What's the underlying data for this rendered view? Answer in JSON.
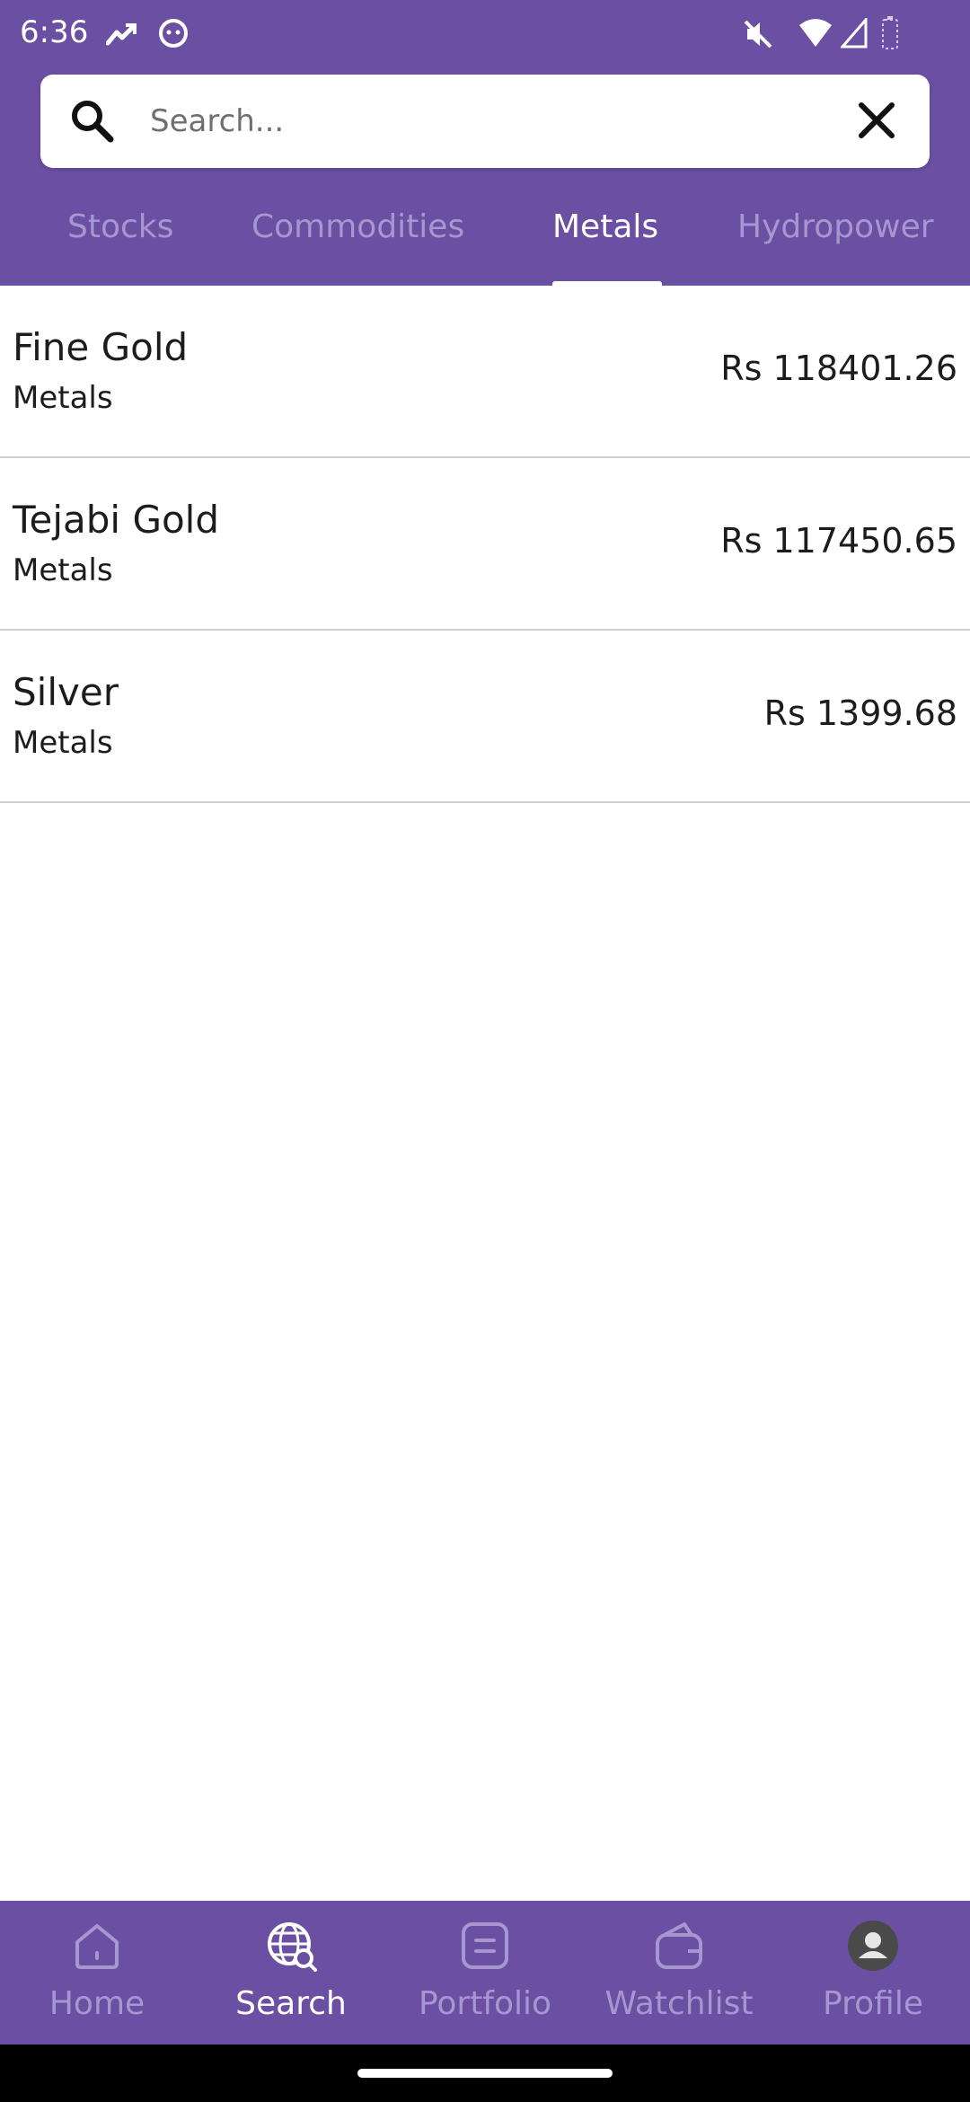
{
  "status_bar": {
    "time": "6:36"
  },
  "search": {
    "placeholder": "Search...",
    "value": ""
  },
  "tabs": [
    {
      "label": "Stocks",
      "active": false
    },
    {
      "label": "Commodities",
      "active": false
    },
    {
      "label": "Metals",
      "active": true
    },
    {
      "label": "Hydropower",
      "active": false
    }
  ],
  "list": [
    {
      "name": "Fine Gold",
      "category": "Metals",
      "price": "Rs 118401.26"
    },
    {
      "name": "Tejabi Gold",
      "category": "Metals",
      "price": "Rs 117450.65"
    },
    {
      "name": "Silver",
      "category": "Metals",
      "price": "Rs 1399.68"
    }
  ],
  "bottom_nav": [
    {
      "label": "Home",
      "icon": "home-icon",
      "active": false
    },
    {
      "label": "Search",
      "icon": "globe-search-icon",
      "active": true
    },
    {
      "label": "Portfolio",
      "icon": "portfolio-icon",
      "active": false
    },
    {
      "label": "Watchlist",
      "icon": "wallet-icon",
      "active": false
    },
    {
      "label": "Profile",
      "icon": "profile-avatar-icon",
      "active": false
    }
  ],
  "colors": {
    "brand": "#6a4fa3",
    "tab_inactive": "#a796cf",
    "tab_active": "#ffffff"
  }
}
